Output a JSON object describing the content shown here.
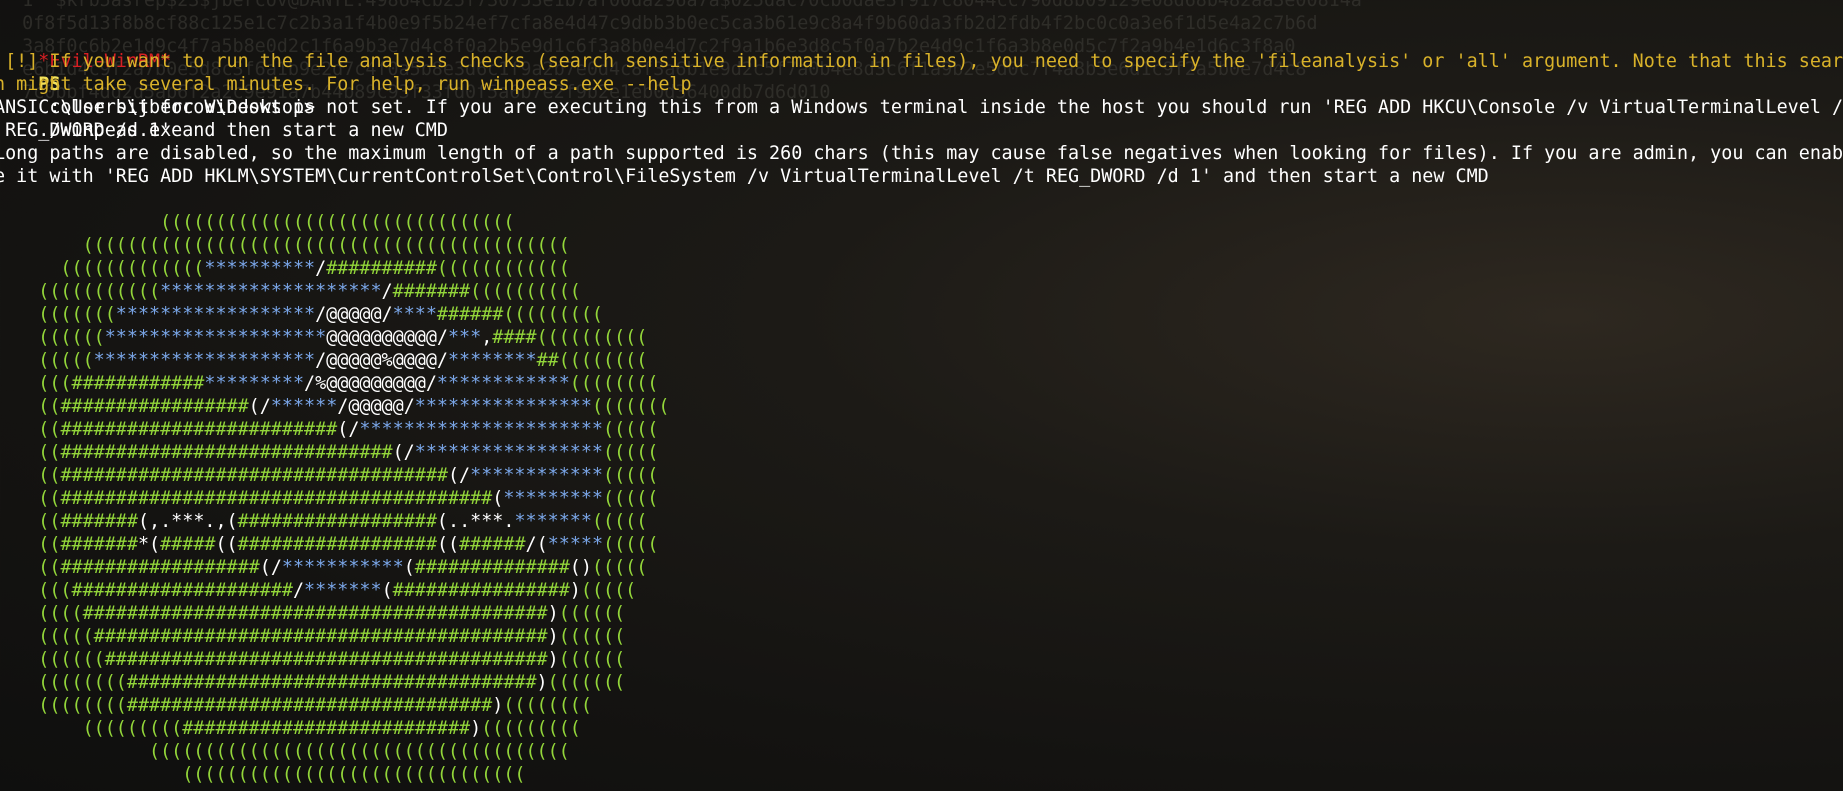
{
  "ghost_lines": [
    "  1  $krb5asrep$23$jbercov@DANTE:49864cb25f730753e1b7af00da296a7a$025dac70cb0dae3f917c8044cc790d8b09129e08d68b482aa3e00814a",
    "  0f8f5d13f8b8cf88c125e1c7c2b3a1f4b0e9f5b24ef7cfa8e4d47c9dbb3b0ec5ca3b61e9c8a4f9b60da3fb2d2fdb4f2bc0c0a3e6f1d5e4a2c7b6d",
    "  3a8f0c6b2e1d9c4f7a5b8e0d2c1f6a9b3e7d4c8f0a2b5e9d1c6f3a8b0e4d7c2f9a1b6e3d8c5f0a7b2e4d9c1f6a3b8e0d5c7f2a9b4e1d6c3f8a0",
    "  e6b1d4c9f2a7b0e5d8c3f6a1b9e2d7c4f0a5b8e3d6c1f9a2b7e0d4c8f3a6b1e9d2c5f7a0b4e8d3c6f1a9b2e5d0c7f4a8b3e6d1c9f2a5b0e7d4c8",
    "  7c0bbf4dd2d5ab6f2a2c9e91a7b44b89c93f33fd0f5a6b7e2f9b2e1eb0d36400db7d6d010"
  ],
  "prompt": {
    "evil": "*Evil-WinRM*",
    "ps": "PS",
    "path": "C:\\Users\\jbercov\\Desktop>",
    "command": "./winpeas.exe"
  },
  "messages": [
    {
      "type": "warn",
      "text": " [!] If you want to run the file analysis checks (search sensitive information in files), you need to specify the 'fileanalysis' or 'all' argument. Note that this searc"
    },
    {
      "type": "warn",
      "text": "h might take several minutes. For help, run winpeass.exe --help"
    },
    {
      "type": "info",
      "text": "ANSI color bit for Windows is not set. If you are executing this from a Windows terminal inside the host you should run 'REG ADD HKCU\\Console /v VirtualTerminalLevel /t"
    },
    {
      "type": "info",
      "text": " REG_DWORD /d 1' and then start a new CMD"
    },
    {
      "type": "info",
      "text": "Long paths are disabled, so the maximum length of a path supported is 260 chars (this may cause false negatives when looking for files). If you are admin, you can enabl"
    },
    {
      "type": "info",
      "text": "e it with 'REG ADD HKLM\\SYSTEM\\CurrentControlSet\\Control\\FileSystem /v VirtualTerminalLevel /t REG_DWORD /d 1' and then start a new CMD"
    }
  ],
  "ascii_art": [
    [
      [
        "g",
        "               (((((((((((((((((((((((((((((((("
      ]
    ],
    [
      [
        "g",
        "        (((((((((((((((((((((((((((((((((((((((((((("
      ]
    ],
    [
      [
        "g",
        "      ((((((((((((("
      ],
      [
        "b",
        "**********"
      ],
      [
        "w",
        "/"
      ],
      [
        "g",
        "##########(((((((((((("
      ]
    ],
    [
      [
        "g",
        "    ((((((((((("
      ],
      [
        "b",
        "********************"
      ],
      [
        "w",
        "/"
      ],
      [
        "g",
        "#######(((((((((("
      ]
    ],
    [
      [
        "g",
        "    ((((((("
      ],
      [
        "b",
        "******************"
      ],
      [
        "w",
        "/@@@@@/"
      ],
      [
        "b",
        "****"
      ],
      [
        "g",
        "######((((((((("
      ]
    ],
    [
      [
        "g",
        "    (((((("
      ],
      [
        "b",
        "********************"
      ],
      [
        "w",
        "@@@@@@@@@@/"
      ],
      [
        "b",
        "***"
      ],
      [
        "w",
        ","
      ],
      [
        "g",
        "####(((((((((("
      ]
    ],
    [
      [
        "g",
        "    ((((("
      ],
      [
        "b",
        "********************"
      ],
      [
        "w",
        "/@@@@@%@@@@/"
      ],
      [
        "b",
        "********"
      ],
      [
        "g",
        "##(((((((("
      ]
    ],
    [
      [
        "g",
        "    ((("
      ],
      [
        "g",
        "############"
      ],
      [
        "b",
        "*********"
      ],
      [
        "w",
        "/%@@@@@@@@@/"
      ],
      [
        "b",
        "************"
      ],
      [
        "g",
        "(((((((("
      ]
    ],
    [
      [
        "g",
        "    (("
      ],
      [
        "g",
        "#################"
      ],
      [
        "w",
        "(/"
      ],
      [
        "b",
        "******"
      ],
      [
        "w",
        "/@@@@@/"
      ],
      [
        "b",
        "****************"
      ],
      [
        "g",
        "((((((("
      ]
    ],
    [
      [
        "g",
        "    (("
      ],
      [
        "g",
        "#########################"
      ],
      [
        "w",
        "(/"
      ],
      [
        "b",
        "**********************"
      ],
      [
        "g",
        "((((("
      ]
    ],
    [
      [
        "g",
        "    (("
      ],
      [
        "g",
        "##############################"
      ],
      [
        "w",
        "(/"
      ],
      [
        "b",
        "*****************"
      ],
      [
        "g",
        "((((("
      ]
    ],
    [
      [
        "g",
        "    (("
      ],
      [
        "g",
        "###################################"
      ],
      [
        "w",
        "(/"
      ],
      [
        "b",
        "************"
      ],
      [
        "g",
        "((((("
      ]
    ],
    [
      [
        "g",
        "    (("
      ],
      [
        "g",
        "#######################################"
      ],
      [
        "w",
        "("
      ],
      [
        "b",
        "*********"
      ],
      [
        "g",
        "((((("
      ]
    ],
    [
      [
        "g",
        "    (("
      ],
      [
        "g",
        "#######"
      ],
      [
        "w",
        "(,.***.,("
      ],
      [
        "g",
        "##################"
      ],
      [
        "w",
        "(..***."
      ],
      [
        "b",
        "*******"
      ],
      [
        "g",
        "((((("
      ]
    ],
    [
      [
        "g",
        "    (("
      ],
      [
        "g",
        "#######"
      ],
      [
        "w",
        "*("
      ],
      [
        "g",
        "#####"
      ],
      [
        "w",
        "(("
      ],
      [
        "g",
        "##################"
      ],
      [
        "w",
        "(("
      ],
      [
        "g",
        "######"
      ],
      [
        "w",
        "/("
      ],
      [
        "b",
        "*****"
      ],
      [
        "g",
        "((((("
      ]
    ],
    [
      [
        "g",
        "    (("
      ],
      [
        "g",
        "##################"
      ],
      [
        "w",
        "(/"
      ],
      [
        "b",
        "***********"
      ],
      [
        "w",
        "("
      ],
      [
        "g",
        "##############"
      ],
      [
        "w",
        "()"
      ],
      [
        "g",
        "((((("
      ]
    ],
    [
      [
        "g",
        "    ((("
      ],
      [
        "g",
        "####################"
      ],
      [
        "w",
        "/"
      ],
      [
        "b",
        "*******"
      ],
      [
        "w",
        "("
      ],
      [
        "g",
        "################"
      ],
      [
        "w",
        ")"
      ],
      [
        "g",
        "((((("
      ]
    ],
    [
      [
        "g",
        "    (((("
      ],
      [
        "g",
        "##########################################"
      ],
      [
        "w",
        ")"
      ],
      [
        "g",
        "(((((("
      ]
    ],
    [
      [
        "g",
        "    ((((("
      ],
      [
        "g",
        "#########################################"
      ],
      [
        "w",
        ")"
      ],
      [
        "g",
        "(((((("
      ]
    ],
    [
      [
        "g",
        "    (((((("
      ],
      [
        "g",
        "########################################"
      ],
      [
        "w",
        ")"
      ],
      [
        "g",
        "(((((("
      ]
    ],
    [
      [
        "g",
        "    (((((((("
      ],
      [
        "g",
        "#####################################"
      ],
      [
        "w",
        ")"
      ],
      [
        "g",
        "((((((("
      ]
    ],
    [
      [
        "g",
        "    (((((((("
      ],
      [
        "g",
        "#################################"
      ],
      [
        "w",
        ")"
      ],
      [
        "g",
        "(((((((("
      ]
    ],
    [
      [
        "g",
        "        ((((((((("
      ],
      [
        "g",
        "##########################"
      ],
      [
        "w",
        ")"
      ],
      [
        "g",
        "((((((((("
      ]
    ],
    [
      [
        "g",
        "              (((((((((((((((((((((((((((((((((((((("
      ]
    ],
    [
      [
        "g",
        "                 ((((((((((((((((((((((((((((((("
      ]
    ]
  ],
  "colors": {
    "prompt_evil": "#d61f23",
    "prompt_ps": "#f5e35a",
    "warning": "#d9b22a",
    "art_green": "#93d63a",
    "art_blue": "#7aa6e8",
    "text_white": "#ffffff",
    "background": "#141311"
  }
}
